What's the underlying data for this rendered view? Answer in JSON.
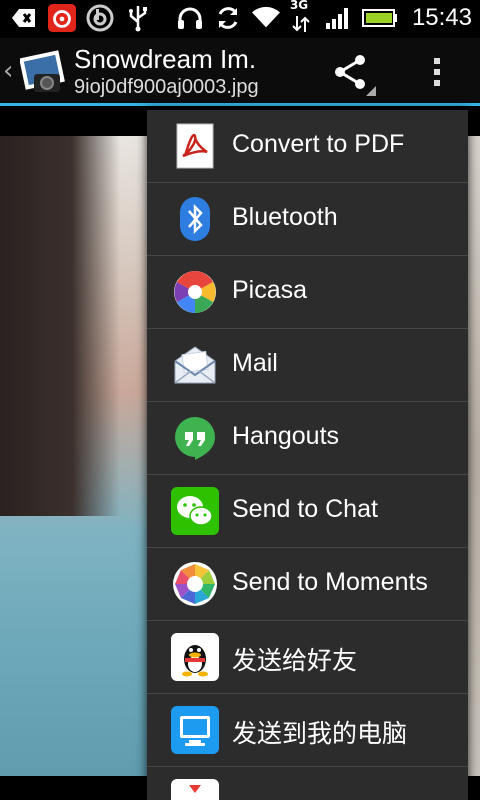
{
  "status_bar": {
    "time": "15:43",
    "network_type": "3G",
    "icons": [
      "usb-debug-icon",
      "netease-music-icon",
      "beats-audio-icon",
      "usb-icon",
      "headphones-icon",
      "sync-icon",
      "wifi-icon",
      "signal-icon",
      "battery-icon"
    ]
  },
  "action_bar": {
    "title": "Snowdream Im.",
    "subtitle": "9ioj0df900aj0003.jpg",
    "accent_color": "#33b5e5"
  },
  "share_menu": {
    "items": [
      {
        "label": "Convert to PDF",
        "icon": "pdf-icon"
      },
      {
        "label": "Bluetooth",
        "icon": "bluetooth-icon"
      },
      {
        "label": "Picasa",
        "icon": "picasa-icon"
      },
      {
        "label": "Mail",
        "icon": "mail-icon"
      },
      {
        "label": "Hangouts",
        "icon": "hangouts-icon"
      },
      {
        "label": "Send to Chat",
        "icon": "wechat-icon"
      },
      {
        "label": "Send to Moments",
        "icon": "moments-icon"
      },
      {
        "label": "发送给好友",
        "icon": "qq-icon"
      },
      {
        "label": "发送到我的电脑",
        "icon": "qq-computer-icon"
      }
    ]
  }
}
